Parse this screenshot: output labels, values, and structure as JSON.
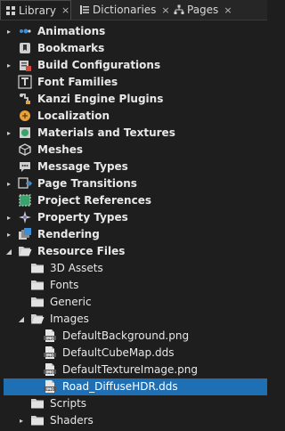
{
  "tabs": [
    {
      "label": "Library",
      "close": "×"
    },
    {
      "label": "Dictionaries",
      "close": "×"
    },
    {
      "label": "Pages",
      "close": "×"
    }
  ],
  "tree": [
    {
      "label": "Animations",
      "arrow": "▸",
      "icon": "animation-icon"
    },
    {
      "label": "Bookmarks",
      "arrow": "",
      "icon": "bookmark-icon"
    },
    {
      "label": "Build Configurations",
      "arrow": "▸",
      "icon": "build-configuration-icon"
    },
    {
      "label": "Font Families",
      "arrow": "",
      "icon": "font-icon"
    },
    {
      "label": "Kanzi Engine Plugins",
      "arrow": "",
      "icon": "plugin-icon"
    },
    {
      "label": "Localization",
      "arrow": "",
      "icon": "localization-icon"
    },
    {
      "label": "Materials and Textures",
      "arrow": "▸",
      "icon": "material-icon"
    },
    {
      "label": "Meshes",
      "arrow": "",
      "icon": "mesh-icon"
    },
    {
      "label": "Message Types",
      "arrow": "",
      "icon": "message-icon"
    },
    {
      "label": "Page Transitions",
      "arrow": "▸",
      "icon": "page-transition-icon"
    },
    {
      "label": "Project References",
      "arrow": "",
      "icon": "project-reference-icon"
    },
    {
      "label": "Property Types",
      "arrow": "▸",
      "icon": "property-type-icon"
    },
    {
      "label": "Rendering",
      "arrow": "▸",
      "icon": "rendering-icon"
    },
    {
      "label": "Resource Files",
      "arrow": "◢",
      "icon": "folder-open-icon"
    },
    {
      "label": "3D Assets",
      "arrow": "",
      "icon": "folder-icon"
    },
    {
      "label": "Fonts",
      "arrow": "",
      "icon": "folder-icon"
    },
    {
      "label": "Generic",
      "arrow": "",
      "icon": "folder-icon"
    },
    {
      "label": "Images",
      "arrow": "◢",
      "icon": "folder-open-icon"
    },
    {
      "label": "DefaultBackground.png",
      "arrow": "",
      "icon": "image-file-icon"
    },
    {
      "label": "DefaultCubeMap.dds",
      "arrow": "",
      "icon": "image-file-icon"
    },
    {
      "label": "DefaultTextureImage.png",
      "arrow": "",
      "icon": "image-file-icon"
    },
    {
      "label": "Road_DiffuseHDR.dds",
      "arrow": "",
      "icon": "image-file-icon"
    },
    {
      "label": "Scripts",
      "arrow": "",
      "icon": "folder-icon"
    },
    {
      "label": "Shaders",
      "arrow": "▸",
      "icon": "folder-icon"
    }
  ],
  "file_icon_text": "IMG",
  "selected_item": "Road_DiffuseHDR.dds",
  "colors": {
    "background": "#1e1e1e",
    "selection": "#1f6fb5",
    "folder": "#cfcfcf",
    "accent_blue": "#3b8fd6",
    "accent_green": "#6fbf4a"
  }
}
